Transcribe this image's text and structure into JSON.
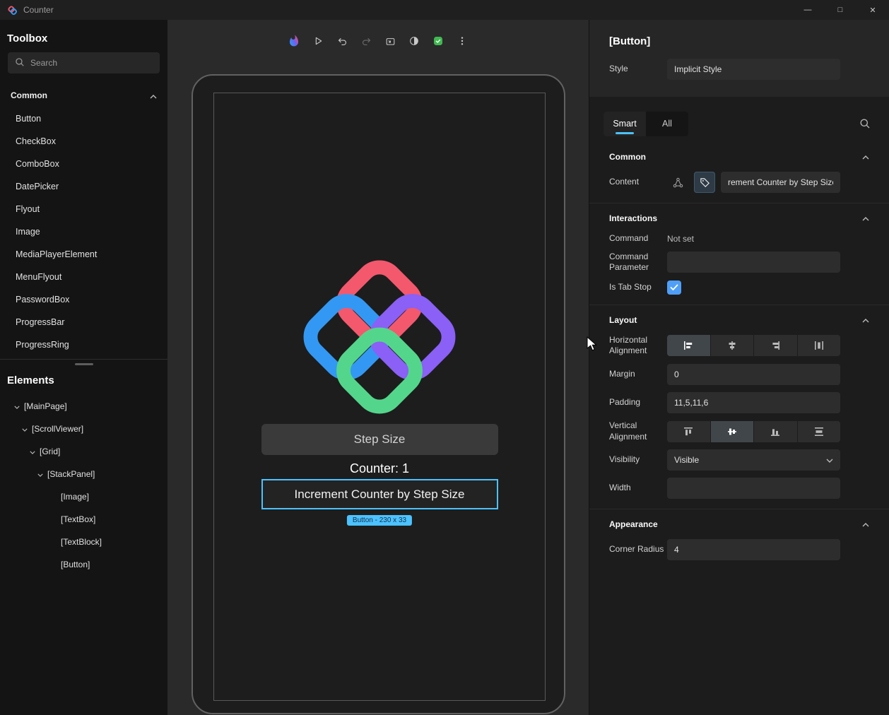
{
  "colors": {
    "accent": "#4cc2ff",
    "checkbox": "#4f9ff8",
    "status_ok": "#3fb950"
  },
  "window": {
    "title": "Counter",
    "minimize": "—",
    "maximize": "□",
    "close": "✕"
  },
  "toolbox": {
    "title": "Toolbox",
    "search_placeholder": "Search",
    "section_title": "Common",
    "items": [
      "Button",
      "CheckBox",
      "ComboBox",
      "DatePicker",
      "Flyout",
      "Image",
      "MediaPlayerElement",
      "MenuFlyout",
      "PasswordBox",
      "ProgressBar",
      "ProgressRing"
    ]
  },
  "elements_panel": {
    "title": "Elements",
    "tree": [
      {
        "label": "[MainPage]"
      },
      {
        "label": "[ScrollViewer]"
      },
      {
        "label": "[Grid]"
      },
      {
        "label": "[StackPanel]"
      },
      {
        "label": "[Image]"
      },
      {
        "label": "[TextBox]"
      },
      {
        "label": "[TextBlock]"
      },
      {
        "label": "[Button]"
      }
    ]
  },
  "canvas": {
    "step_size_text": "Step Size",
    "counter_text": "Counter: 1",
    "button_label": "Increment Counter by Step Size",
    "selection_badge": "Button - 230 x 33"
  },
  "inspector": {
    "selected_element": "[Button]",
    "style_label": "Style",
    "style_value": "Implicit Style",
    "tab_smart": "Smart",
    "tab_all": "All",
    "common": {
      "title": "Common",
      "content_label": "Content",
      "content_value": "rement Counter by Step Size"
    },
    "interactions": {
      "title": "Interactions",
      "command_label": "Command",
      "command_value": "Not set",
      "command_parameter_label": "Command Parameter",
      "is_tab_stop_label": "Is Tab Stop"
    },
    "layout": {
      "title": "Layout",
      "horizontal_alignment_label": "Horizontal Alignment",
      "margin_label": "Margin",
      "margin_value": "0",
      "padding_label": "Padding",
      "padding_value": "11,5,11,6",
      "vertical_alignment_label": "Vertical Alignment",
      "visibility_label": "Visibility",
      "visibility_value": "Visible",
      "width_label": "Width"
    },
    "appearance": {
      "title": "Appearance",
      "corner_radius_label": "Corner Radius",
      "corner_radius_value": "4"
    }
  }
}
